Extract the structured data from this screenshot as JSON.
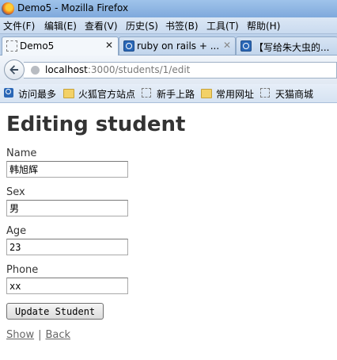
{
  "window": {
    "title": "Demo5 - Mozilla Firefox"
  },
  "menubar": {
    "items": [
      "文件(F)",
      "编辑(E)",
      "查看(V)",
      "历史(S)",
      "书签(B)",
      "工具(T)",
      "帮助(H)"
    ]
  },
  "tabs": [
    {
      "label": "Demo5",
      "active": true
    },
    {
      "label": "ruby on rails + ...",
      "active": false
    },
    {
      "label": "【写给朱大虫的...",
      "active": false
    }
  ],
  "navbar": {
    "url_host": "localhost",
    "url_path": ":3000/students/1/edit"
  },
  "bookmarks": [
    "访问最多",
    "火狐官方站点",
    "新手上路",
    "常用网址",
    "天猫商城"
  ],
  "page": {
    "heading": "Editing student",
    "fields": {
      "name": {
        "label": "Name",
        "value": "韩旭辉"
      },
      "sex": {
        "label": "Sex",
        "value": "男"
      },
      "age": {
        "label": "Age",
        "value": "23"
      },
      "phone": {
        "label": "Phone",
        "value": "xx"
      }
    },
    "submit_label": "Update Student",
    "links": {
      "show": "Show",
      "separator": "|",
      "back": "Back"
    }
  }
}
